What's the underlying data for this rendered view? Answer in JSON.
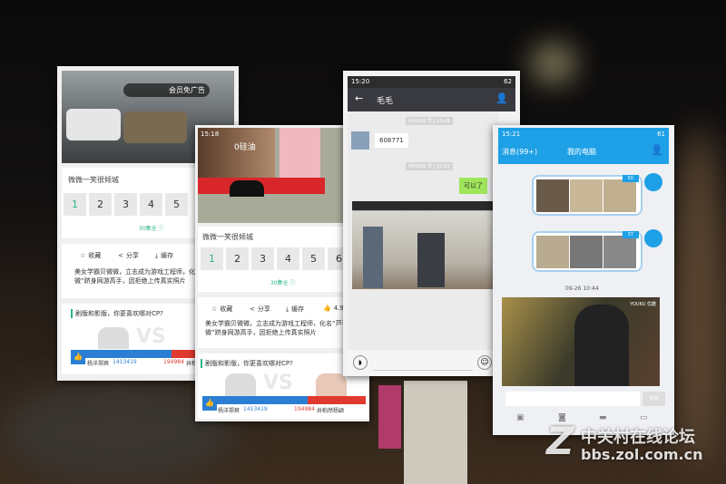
{
  "panel_video1": {
    "ad_label": "会员免广告",
    "title": "微微一笑很倾城",
    "episodes": [
      "1",
      "2",
      "3",
      "4",
      "5"
    ],
    "all_episodes": "30集全 ⓘ",
    "actions": [
      "收藏",
      "分享",
      "缓存"
    ],
    "description": "美女学霸贝微微，立志成为游戏工程师，化名“芦苇微微”跻身网游高手，因拒绝上传真实照片",
    "poll_title": "剧版和影版，你更喜欢哪对CP?",
    "poll_left_name": "杨洋郑爽",
    "poll_left_votes": "1413419",
    "poll_right_votes": "194984",
    "poll_right_name": "井柏然杨颖",
    "vs": "VS"
  },
  "panel_video2": {
    "status_time": "15:18",
    "ad_text": "0硅油",
    "title": "微微一笑很倾城",
    "episodes": [
      "1",
      "2",
      "3",
      "4",
      "5",
      "6"
    ],
    "all_episodes": "30集全 ⓘ",
    "actions": [
      "收藏",
      "分享",
      "缓存",
      "4.9"
    ],
    "description": "美女学霸贝微微，立志成为游戏工程师，化名“芦苇微微”跻身网游高手，因拒绝上传真实照片",
    "poll_title": "剧版和影版，你更喜欢哪对CP?",
    "poll_left_name": "杨洋郑爽",
    "poll_left_votes": "1413419",
    "poll_right_votes": "194984",
    "poll_right_name": "井柏然杨颖",
    "vs": "VS"
  },
  "panel_wechat": {
    "status_time": "15:20",
    "battery": "62",
    "contact": "毛毛",
    "timestamp1": "9月26日 早上10:48",
    "message1": "608771",
    "timestamp2": "9月26日 早上10:52",
    "message2": "可以了"
  },
  "panel_qq": {
    "status_time": "15:21",
    "battery": "61",
    "back_label": "消息(99+)",
    "title": "我的电脑",
    "badge1": "50",
    "badge2": "37",
    "timestamp": "09-26 10:44",
    "video_logo": "YOUKU 优酷",
    "send_label": "发送"
  },
  "watermark": {
    "line1": "中关村在线论坛",
    "line2": "bbs.zol.com.cn"
  },
  "colors": {
    "wechat_green": "#9fe55a",
    "qq_blue": "#1ea0e6",
    "accent_green": "#2cb58a",
    "poll_blue": "#2a7fd4",
    "poll_red": "#e03a2e"
  }
}
